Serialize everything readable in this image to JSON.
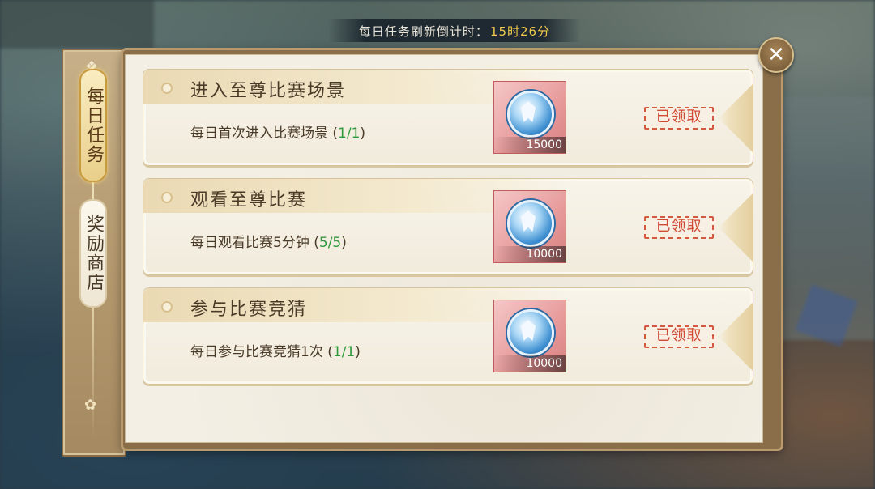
{
  "countdown": {
    "label": "每日任务刷新倒计时：",
    "value": "15时26分"
  },
  "sidebar": {
    "tabs": [
      {
        "label": "每日任务",
        "active": true
      },
      {
        "label": "奖励商店",
        "active": false
      }
    ]
  },
  "close_icon": "close-icon",
  "tasks": [
    {
      "title": "进入至尊比赛场景",
      "desc": "每日首次进入比赛场景",
      "progress": "1/1",
      "reward_amount": "15000",
      "status": "已领取"
    },
    {
      "title": "观看至尊比赛",
      "desc": "每日观看比赛5分钟",
      "progress": "5/5",
      "reward_amount": "10000",
      "status": "已领取"
    },
    {
      "title": "参与比赛竞猜",
      "desc": "每日参与比赛竞猜1次",
      "progress": "1/1",
      "reward_amount": "10000",
      "status": "已领取"
    }
  ],
  "colors": {
    "progress_green": "#2e9a3c",
    "stamp_red": "#cf4a33",
    "countdown_gold": "#f2c94c"
  }
}
